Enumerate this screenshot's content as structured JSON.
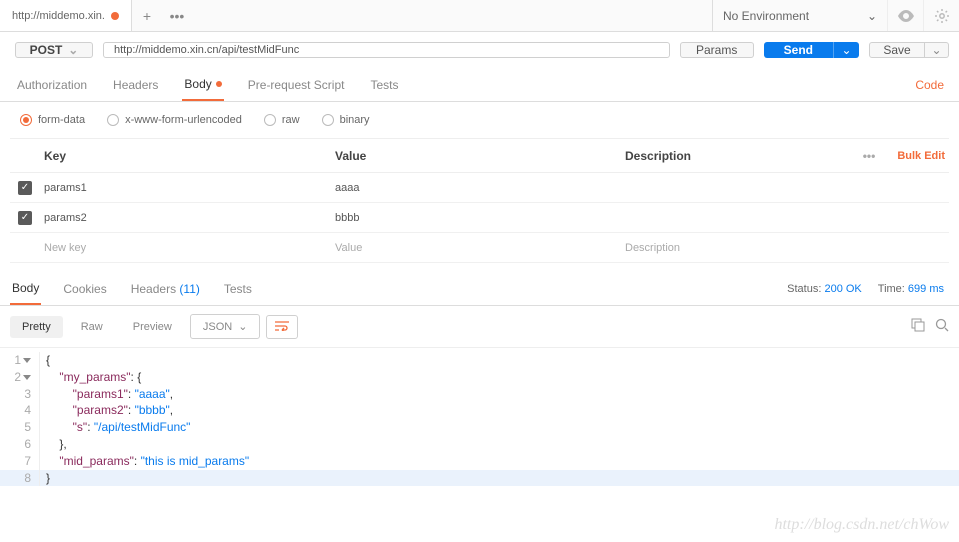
{
  "topbar": {
    "tab_title": "http://middemo.xin.",
    "environment": "No Environment"
  },
  "request": {
    "method": "POST",
    "url": "http://middemo.xin.cn/api/testMidFunc",
    "params_btn": "Params",
    "send": "Send",
    "save": "Save"
  },
  "rtabs": {
    "authorization": "Authorization",
    "headers": "Headers",
    "body": "Body",
    "prerequest": "Pre-request Script",
    "tests": "Tests",
    "code": "Code"
  },
  "body_types": {
    "form_data": "form-data",
    "urlencoded": "x-www-form-urlencoded",
    "raw": "raw",
    "binary": "binary"
  },
  "table": {
    "head_key": "Key",
    "head_value": "Value",
    "head_desc": "Description",
    "bulk_edit": "Bulk Edit",
    "dots": "•••",
    "rows": [
      {
        "key": "params1",
        "value": "aaaa",
        "checked": true
      },
      {
        "key": "params2",
        "value": "bbbb",
        "checked": true
      }
    ],
    "placeholder_key": "New key",
    "placeholder_value": "Value",
    "placeholder_desc": "Description"
  },
  "response": {
    "tabs": {
      "body": "Body",
      "cookies": "Cookies",
      "headers": "Headers",
      "headers_count": "(11)",
      "tests": "Tests"
    },
    "status_label": "Status:",
    "status_value": "200 OK",
    "time_label": "Time:",
    "time_value": "699 ms",
    "view": {
      "pretty": "Pretty",
      "raw": "Raw",
      "preview": "Preview",
      "format": "JSON"
    }
  },
  "code_lines": [
    {
      "n": "1",
      "fold": true,
      "indent": 0,
      "tokens": [
        [
          "",
          "{"
        ]
      ]
    },
    {
      "n": "2",
      "fold": true,
      "indent": 1,
      "tokens": [
        [
          "key",
          "\"my_params\""
        ],
        [
          "",
          ": {"
        ]
      ]
    },
    {
      "n": "3",
      "indent": 2,
      "tokens": [
        [
          "key",
          "\"params1\""
        ],
        [
          "",
          ": "
        ],
        [
          "str",
          "\"aaaa\""
        ],
        [
          "",
          ","
        ]
      ]
    },
    {
      "n": "4",
      "indent": 2,
      "tokens": [
        [
          "key",
          "\"params2\""
        ],
        [
          "",
          ": "
        ],
        [
          "str",
          "\"bbbb\""
        ],
        [
          "",
          ","
        ]
      ]
    },
    {
      "n": "5",
      "indent": 2,
      "tokens": [
        [
          "key",
          "\"s\""
        ],
        [
          "",
          ": "
        ],
        [
          "str",
          "\"/api/testMidFunc\""
        ]
      ]
    },
    {
      "n": "6",
      "indent": 1,
      "tokens": [
        [
          "",
          "},"
        ]
      ]
    },
    {
      "n": "7",
      "indent": 1,
      "tokens": [
        [
          "key",
          "\"mid_params\""
        ],
        [
          "",
          ": "
        ],
        [
          "str",
          "\"this is mid_params\""
        ]
      ]
    },
    {
      "n": "8",
      "hl": true,
      "indent": 0,
      "tokens": [
        [
          "",
          "}"
        ]
      ]
    }
  ],
  "watermark": "http://blog.csdn.net/chWow"
}
